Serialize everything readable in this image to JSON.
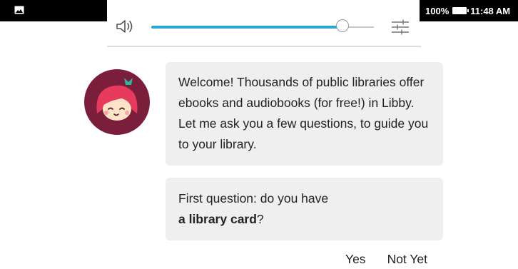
{
  "status_bar": {
    "battery": "100%",
    "time": "11:48 AM",
    "icons": [
      "picture-icon",
      "battery-icon"
    ]
  },
  "player": {
    "volume_fraction": 0.86,
    "icons": [
      "speaker-icon",
      "settings-sliders-icon"
    ],
    "accent_color": "#2aa6cf"
  },
  "chat": {
    "avatar": "libby-avatar",
    "message_1": "Welcome! Thousands of public libraries offer ebooks and audiobooks (for free!) in Libby. Let me ask you a few questions, to guide you to your library.",
    "message_2_prefix": "First question: do you have",
    "message_2_bold": "a library card",
    "message_2_suffix": "?"
  },
  "answers": {
    "yes": "Yes",
    "not_yet": "Not Yet"
  },
  "colors": {
    "bubble": "#efefef",
    "avatar_bg": "#7a1e3c"
  }
}
